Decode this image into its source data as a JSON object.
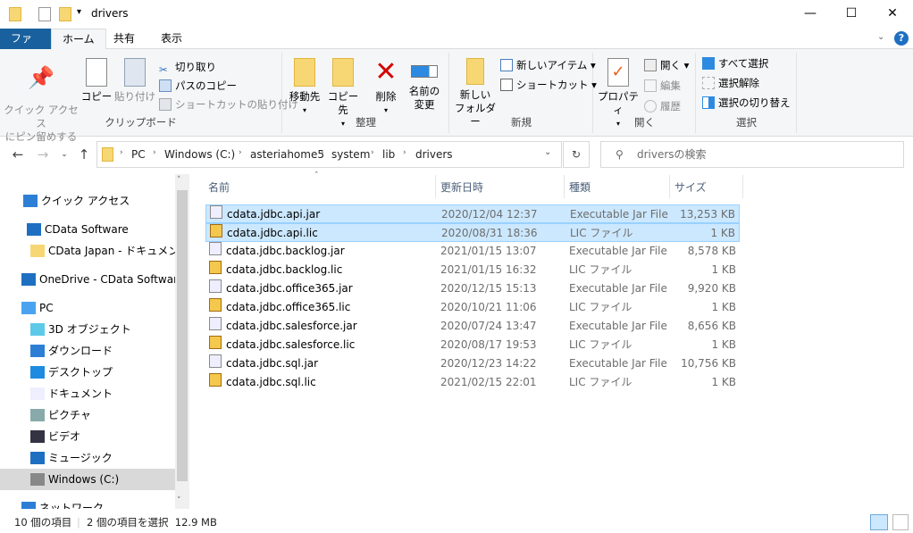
{
  "window": {
    "title": "drivers",
    "minimize": "—",
    "maximize": "☐",
    "close": "✕"
  },
  "ribbon_tabs": [
    {
      "label": "ファイル"
    },
    {
      "label": "ホーム"
    },
    {
      "label": "共有"
    },
    {
      "label": "表示"
    }
  ],
  "ribbon": {
    "clipboard": {
      "label": "クリップボード",
      "pin": "クイック アクセス\nにピン留めする",
      "copy": "コピー",
      "paste": "貼り付け",
      "cut": "切り取り",
      "copy_path": "パスのコピー",
      "paste_shortcut": "ショートカットの貼り付け"
    },
    "organize": {
      "label": "整理",
      "move_to": "移動先",
      "copy_to": "コピー先",
      "delete": "削除",
      "rename": "名前の\n変更"
    },
    "new": {
      "label": "新規",
      "new_folder": "新しい\nフォルダー",
      "new_item": "新しいアイテム",
      "shortcut": "ショートカット"
    },
    "open": {
      "label": "開く",
      "properties": "プロパティ",
      "open": "開く",
      "edit": "編集",
      "history": "履歴"
    },
    "select": {
      "label": "選択",
      "select_all": "すべて選択",
      "select_none": "選択解除",
      "invert": "選択の切り替え"
    }
  },
  "address": {
    "crumbs": [
      "PC",
      "Windows (C:)",
      "asteriahome5",
      "system",
      "lib",
      "drivers"
    ],
    "search_placeholder": "driversの検索"
  },
  "sidebar": {
    "items": [
      {
        "label": "クイック アクセス",
        "icon": "star-icon"
      },
      {
        "label": "CData Software",
        "icon": "building-icon"
      },
      {
        "label": "CData Japan - ドキュメント",
        "icon": "folder-icon"
      },
      {
        "label": "OneDrive - CData Software",
        "icon": "cloud-icon"
      },
      {
        "label": "PC",
        "icon": "pc-icon"
      },
      {
        "label": "3D オブジェクト",
        "icon": "cube-icon"
      },
      {
        "label": "ダウンロード",
        "icon": "download-icon"
      },
      {
        "label": "デスクトップ",
        "icon": "desktop-icon"
      },
      {
        "label": "ドキュメント",
        "icon": "document-icon"
      },
      {
        "label": "ピクチャ",
        "icon": "picture-icon"
      },
      {
        "label": "ビデオ",
        "icon": "video-icon"
      },
      {
        "label": "ミュージック",
        "icon": "music-icon"
      },
      {
        "label": "Windows (C:)",
        "icon": "drive-icon"
      },
      {
        "label": "ネットワーク",
        "icon": "network-icon"
      }
    ]
  },
  "columns": [
    "名前",
    "更新日時",
    "種類",
    "サイズ"
  ],
  "files": [
    {
      "name": "cdata.jdbc.api.jar",
      "date": "2020/12/04 12:37",
      "type": "Executable Jar File",
      "size": "13,253 KB",
      "selected": true
    },
    {
      "name": "cdata.jdbc.api.lic",
      "date": "2020/08/31 18:36",
      "type": "LIC ファイル",
      "size": "1 KB",
      "selected": true
    },
    {
      "name": "cdata.jdbc.backlog.jar",
      "date": "2021/01/15 13:07",
      "type": "Executable Jar File",
      "size": "8,578 KB"
    },
    {
      "name": "cdata.jdbc.backlog.lic",
      "date": "2021/01/15 16:32",
      "type": "LIC ファイル",
      "size": "1 KB"
    },
    {
      "name": "cdata.jdbc.office365.jar",
      "date": "2020/12/15 15:13",
      "type": "Executable Jar File",
      "size": "9,920 KB"
    },
    {
      "name": "cdata.jdbc.office365.lic",
      "date": "2020/10/21 11:06",
      "type": "LIC ファイル",
      "size": "1 KB"
    },
    {
      "name": "cdata.jdbc.salesforce.jar",
      "date": "2020/07/24 13:47",
      "type": "Executable Jar File",
      "size": "8,656 KB"
    },
    {
      "name": "cdata.jdbc.salesforce.lic",
      "date": "2020/08/17 19:53",
      "type": "LIC ファイル",
      "size": "1 KB"
    },
    {
      "name": "cdata.jdbc.sql.jar",
      "date": "2020/12/23 14:22",
      "type": "Executable Jar File",
      "size": "10,756 KB"
    },
    {
      "name": "cdata.jdbc.sql.lic",
      "date": "2021/02/15 22:01",
      "type": "LIC ファイル",
      "size": "1 KB"
    }
  ],
  "status": {
    "count": "10 個の項目",
    "selection": "2 個の項目を選択  12.9 MB"
  },
  "colors": {
    "accent": "#19609e",
    "selection": "#cce8ff",
    "selection_border": "#99d1ff"
  }
}
